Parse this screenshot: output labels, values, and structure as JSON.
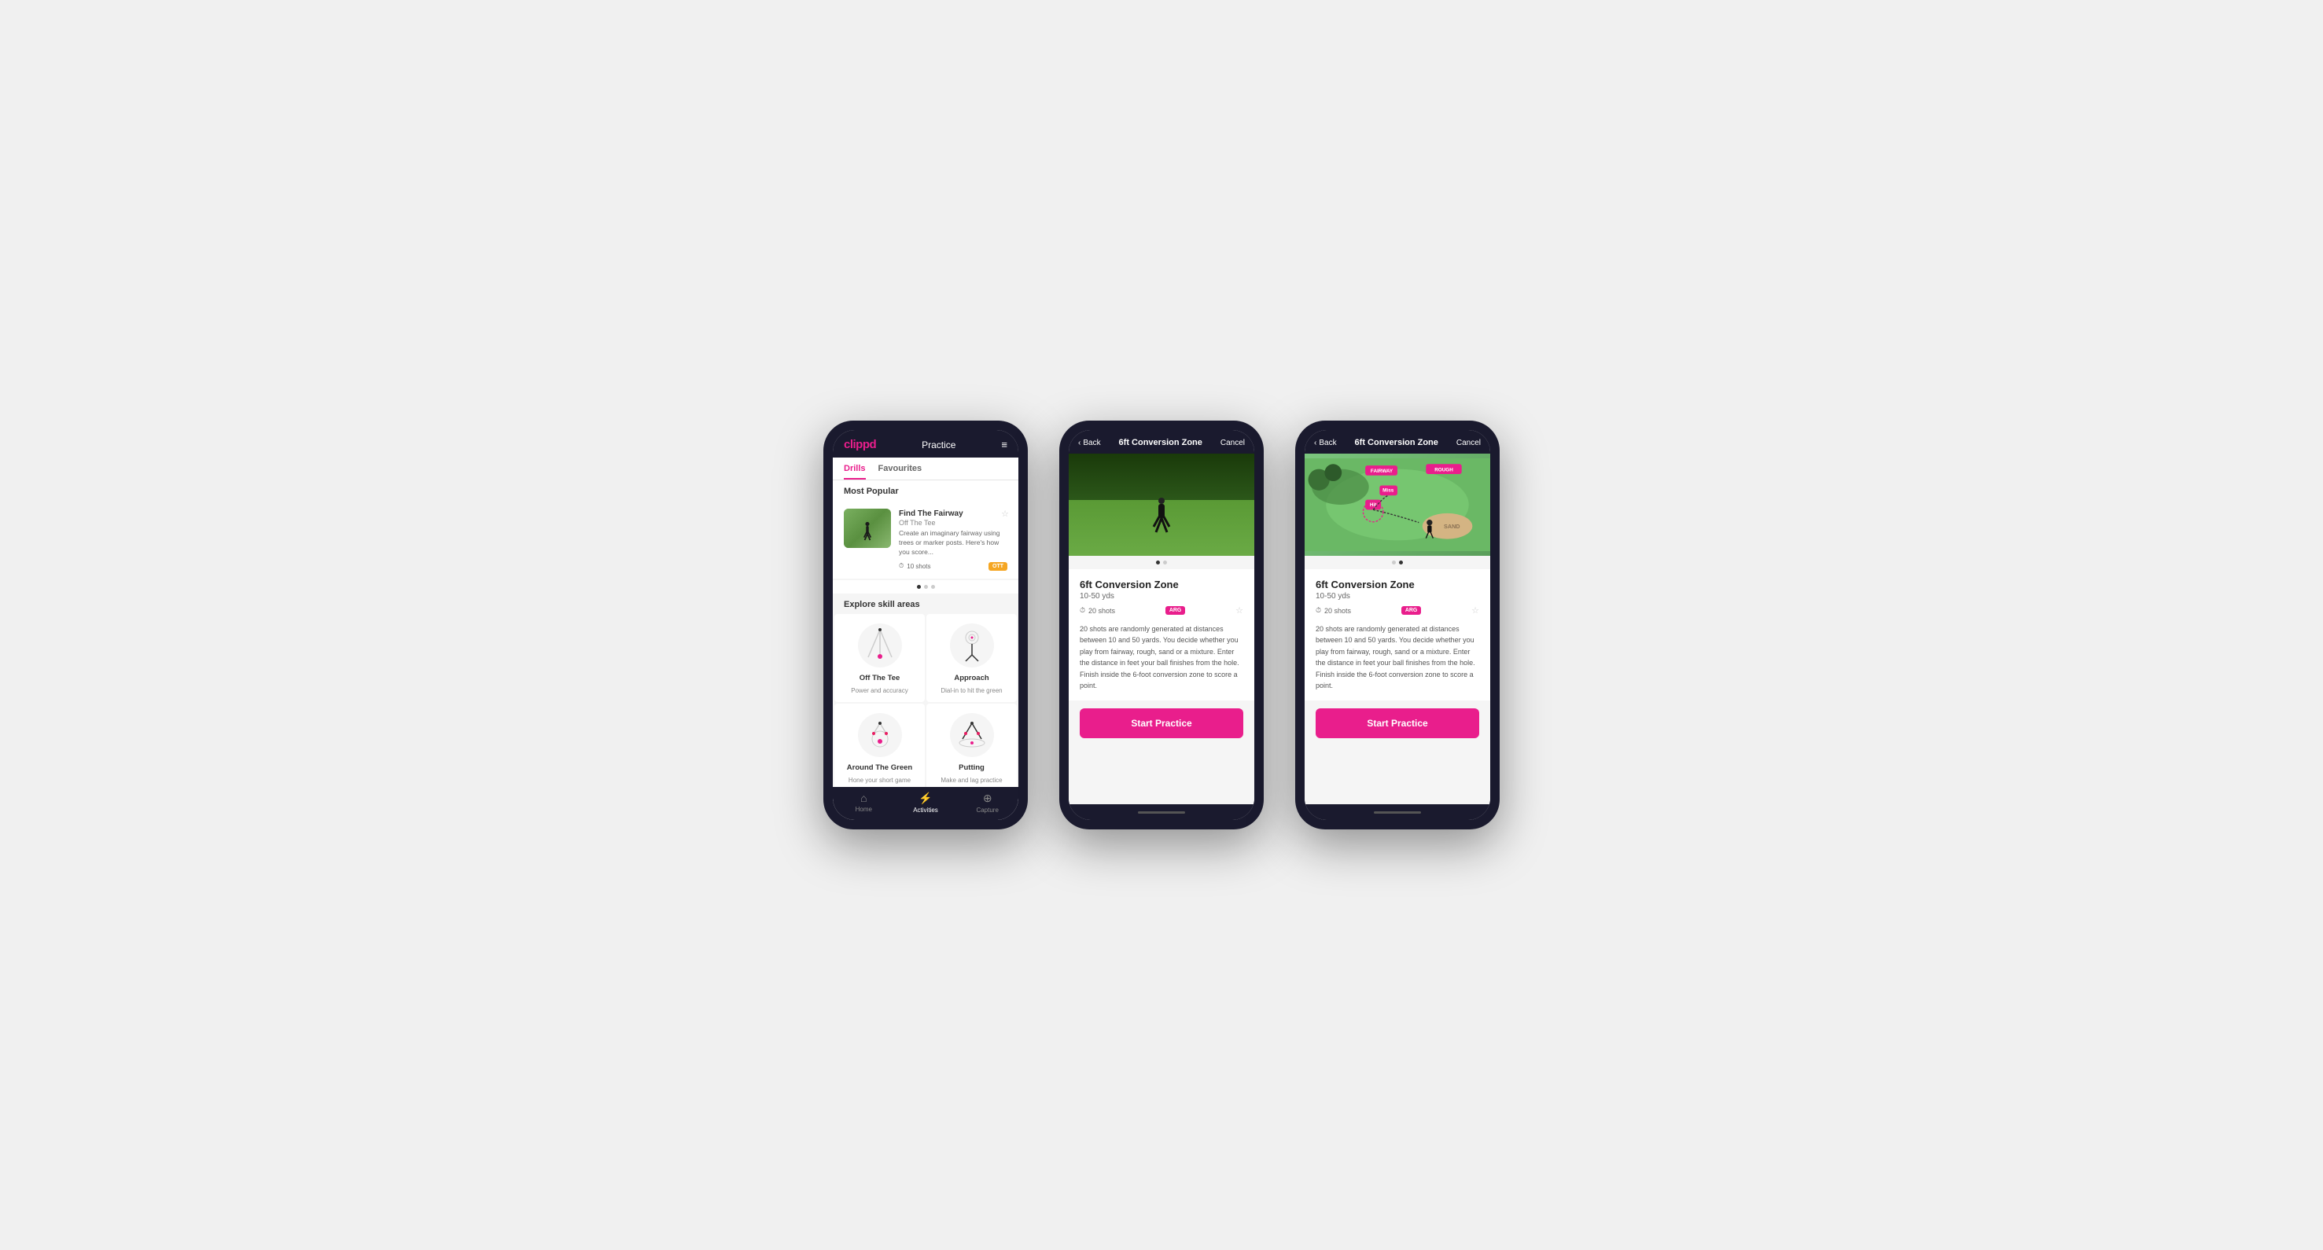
{
  "phone1": {
    "header": {
      "logo": "clippd",
      "title": "Practice",
      "menu_icon": "≡"
    },
    "tabs": [
      {
        "label": "Drills",
        "active": true
      },
      {
        "label": "Favourites",
        "active": false
      }
    ],
    "most_popular_title": "Most Popular",
    "featured_drill": {
      "name": "Find The Fairway",
      "subtitle": "Off The Tee",
      "description": "Create an imaginary fairway using trees or marker posts. Here's how you score...",
      "shots": "10 shots",
      "tag": "OTT"
    },
    "explore_title": "Explore skill areas",
    "skills": [
      {
        "name": "Off The Tee",
        "desc": "Power and accuracy"
      },
      {
        "name": "Approach",
        "desc": "Dial-in to hit the green"
      },
      {
        "name": "Around The Green",
        "desc": "Hone your short game"
      },
      {
        "name": "Putting",
        "desc": "Make and lag practice"
      }
    ],
    "nav": [
      {
        "icon": "⌂",
        "label": "Home",
        "active": false
      },
      {
        "icon": "♟",
        "label": "Activities",
        "active": true
      },
      {
        "icon": "⊕",
        "label": "Capture",
        "active": false
      }
    ]
  },
  "phone2": {
    "header": {
      "back_label": "Back",
      "title": "6ft Conversion Zone",
      "cancel_label": "Cancel"
    },
    "drill": {
      "name": "6ft Conversion Zone",
      "range": "10-50 yds",
      "shots": "20 shots",
      "tag": "ARG",
      "description": "20 shots are randomly generated at distances between 10 and 50 yards. You decide whether you play from fairway, rough, sand or a mixture. Enter the distance in feet your ball finishes from the hole. Finish inside the 6-foot conversion zone to score a point."
    },
    "cta": "Start Practice"
  },
  "phone3": {
    "header": {
      "back_label": "Back",
      "title": "6ft Conversion Zone",
      "cancel_label": "Cancel"
    },
    "drill": {
      "name": "6ft Conversion Zone",
      "range": "10-50 yds",
      "shots": "20 shots",
      "tag": "ARG",
      "description": "20 shots are randomly generated at distances between 10 and 50 yards. You decide whether you play from fairway, rough, sand or a mixture. Enter the distance in feet your ball finishes from the hole. Finish inside the 6-foot conversion zone to score a point."
    },
    "cta": "Start Practice"
  },
  "icons": {
    "clock": "🕐",
    "star": "☆",
    "chevron_left": "‹",
    "home": "⌂",
    "activities": "⚡",
    "capture": "+"
  }
}
